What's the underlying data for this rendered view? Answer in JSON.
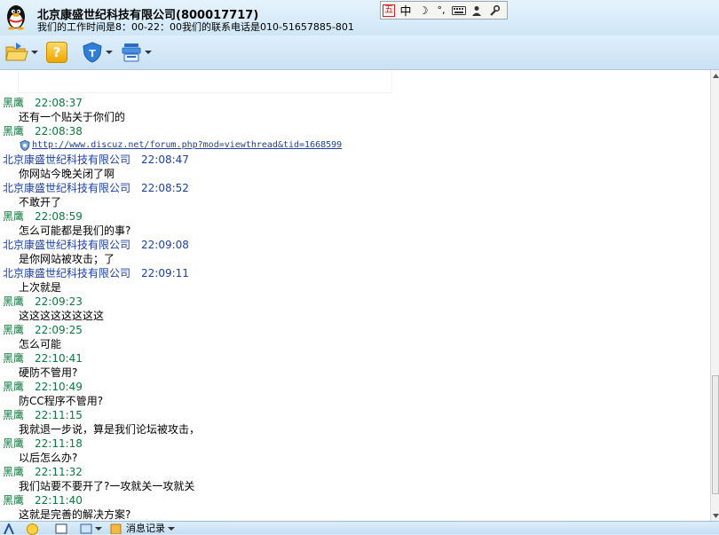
{
  "window": {
    "title": "北京康盛世纪科技有限公司(800017717)",
    "subtitle": "我们的工作时间是8：00-22：00我们的联系电话是010-51657885-801"
  },
  "ime": {
    "items": [
      {
        "icon": "wubi-mode-icon",
        "label": "五"
      },
      {
        "icon": "chinese-mode-icon",
        "label": "中"
      },
      {
        "icon": "half-width-moon-icon",
        "label": "☽"
      },
      {
        "icon": "punctuation-icon",
        "label": "°,"
      },
      {
        "icon": "keyboard-icon",
        "label": "⌨"
      },
      {
        "icon": "user-icon",
        "label": ""
      },
      {
        "icon": "wrench-icon",
        "label": ""
      }
    ]
  },
  "toolbar": {
    "buttons": [
      {
        "icon": "folder-send-icon",
        "has_arrow": true
      },
      {
        "icon": "help-icon",
        "label": "?",
        "has_arrow": false
      },
      {
        "icon": "security-shield-icon",
        "label": "T",
        "has_arrow": true
      },
      {
        "icon": "app-center-icon",
        "has_arrow": true
      }
    ]
  },
  "colors": {
    "self_sender": "#0b7a3c",
    "other_sender": "#1b3fa7",
    "link": "#1f3f9c"
  },
  "messages": [
    {
      "sender": "黑鹰",
      "time": "22:08:37",
      "self": true,
      "lines": [
        "还有一个贴关于你们的"
      ]
    },
    {
      "sender": "黑鹰",
      "time": "22:08:38",
      "self": true,
      "link": "http://www.discuz.net/forum.php?mod=viewthread&tid=1668599"
    },
    {
      "sender": "北京康盛世纪科技有限公司",
      "time": "22:08:47",
      "self": false,
      "lines": [
        "你网站今晚关闭了啊"
      ]
    },
    {
      "sender": "北京康盛世纪科技有限公司",
      "time": "22:08:52",
      "self": false,
      "lines": [
        "不敢开了"
      ]
    },
    {
      "sender": "黑鹰",
      "time": "22:08:59",
      "self": true,
      "lines": [
        "怎么可能都是我们的事?"
      ]
    },
    {
      "sender": "北京康盛世纪科技有限公司",
      "time": "22:09:08",
      "self": false,
      "lines": [
        "是你网站被攻击；了"
      ]
    },
    {
      "sender": "北京康盛世纪科技有限公司",
      "time": "22:09:11",
      "self": false,
      "lines": [
        "上次就是"
      ]
    },
    {
      "sender": "黑鹰",
      "time": "22:09:23",
      "self": true,
      "lines": [
        "这这这这这这这这"
      ]
    },
    {
      "sender": "黑鹰",
      "time": "22:09:25",
      "self": true,
      "lines": [
        "怎么可能"
      ]
    },
    {
      "sender": "黑鹰",
      "time": "22:10:41",
      "self": true,
      "lines": [
        "硬防不管用?"
      ]
    },
    {
      "sender": "黑鹰",
      "time": "22:10:49",
      "self": true,
      "lines": [
        "防CC程序不管用?"
      ]
    },
    {
      "sender": "黑鹰",
      "time": "22:11:15",
      "self": true,
      "lines": [
        "我就退一步说，算是我们论坛被攻击，"
      ]
    },
    {
      "sender": "黑鹰",
      "time": "22:11:18",
      "self": true,
      "lines": [
        "以后怎么办?"
      ]
    },
    {
      "sender": "黑鹰",
      "time": "22:11:32",
      "self": true,
      "lines": [
        "我们站要不要开了?一攻就关一攻就关"
      ]
    },
    {
      "sender": "黑鹰",
      "time": "22:11:40",
      "self": true,
      "lines": [
        "这就是完善的解决方案?"
      ]
    }
  ],
  "bottombar": {
    "history_label": "消息记录"
  }
}
